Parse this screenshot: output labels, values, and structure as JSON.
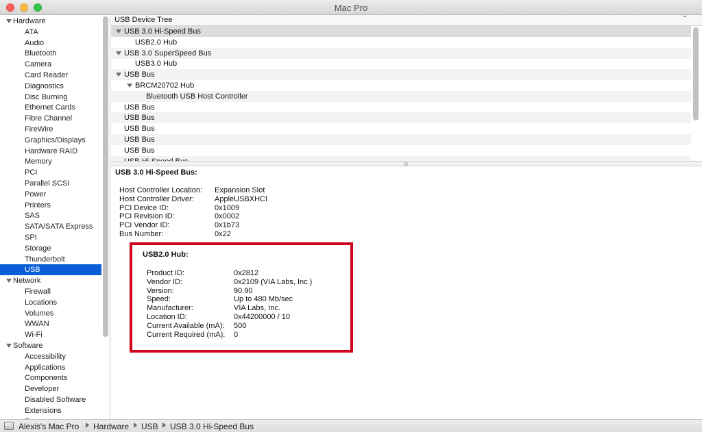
{
  "window": {
    "title": "Mac Pro"
  },
  "sidebar": {
    "items": [
      {
        "label": "Hardware",
        "kind": "category"
      },
      {
        "label": "ATA",
        "kind": "item"
      },
      {
        "label": "Audio",
        "kind": "item"
      },
      {
        "label": "Bluetooth",
        "kind": "item"
      },
      {
        "label": "Camera",
        "kind": "item"
      },
      {
        "label": "Card Reader",
        "kind": "item"
      },
      {
        "label": "Diagnostics",
        "kind": "item"
      },
      {
        "label": "Disc Burning",
        "kind": "item"
      },
      {
        "label": "Ethernet Cards",
        "kind": "item"
      },
      {
        "label": "Fibre Channel",
        "kind": "item"
      },
      {
        "label": "FireWire",
        "kind": "item"
      },
      {
        "label": "Graphics/Displays",
        "kind": "item"
      },
      {
        "label": "Hardware RAID",
        "kind": "item"
      },
      {
        "label": "Memory",
        "kind": "item"
      },
      {
        "label": "PCI",
        "kind": "item"
      },
      {
        "label": "Parallel SCSI",
        "kind": "item"
      },
      {
        "label": "Power",
        "kind": "item"
      },
      {
        "label": "Printers",
        "kind": "item"
      },
      {
        "label": "SAS",
        "kind": "item"
      },
      {
        "label": "SATA/SATA Express",
        "kind": "item"
      },
      {
        "label": "SPI",
        "kind": "item"
      },
      {
        "label": "Storage",
        "kind": "item"
      },
      {
        "label": "Thunderbolt",
        "kind": "item"
      },
      {
        "label": "USB",
        "kind": "item",
        "selected": true
      },
      {
        "label": "Network",
        "kind": "category"
      },
      {
        "label": "Firewall",
        "kind": "item"
      },
      {
        "label": "Locations",
        "kind": "item"
      },
      {
        "label": "Volumes",
        "kind": "item"
      },
      {
        "label": "WWAN",
        "kind": "item"
      },
      {
        "label": "Wi-Fi",
        "kind": "item"
      },
      {
        "label": "Software",
        "kind": "category"
      },
      {
        "label": "Accessibility",
        "kind": "item"
      },
      {
        "label": "Applications",
        "kind": "item"
      },
      {
        "label": "Components",
        "kind": "item"
      },
      {
        "label": "Developer",
        "kind": "item"
      },
      {
        "label": "Disabled Software",
        "kind": "item"
      },
      {
        "label": "Extensions",
        "kind": "item"
      },
      {
        "label": "Fonts",
        "kind": "item"
      }
    ]
  },
  "tree": {
    "header": "USB Device Tree",
    "rows": [
      {
        "label": "USB 3.0 Hi-Speed Bus",
        "level": 0,
        "expanded": true,
        "selected": true
      },
      {
        "label": "USB2.0 Hub",
        "level": 1
      },
      {
        "label": "USB 3.0 SuperSpeed Bus",
        "level": 0,
        "expanded": true
      },
      {
        "label": "USB3.0 Hub",
        "level": 1
      },
      {
        "label": "USB Bus",
        "level": 0,
        "expanded": true
      },
      {
        "label": "BRCM20702 Hub",
        "level": 1,
        "expanded": true
      },
      {
        "label": "Bluetooth USB Host Controller",
        "level": 2
      },
      {
        "label": "USB Bus",
        "level": 0
      },
      {
        "label": "USB Bus",
        "level": 0
      },
      {
        "label": "USB Bus",
        "level": 0
      },
      {
        "label": "USB Bus",
        "level": 0
      },
      {
        "label": "USB Bus",
        "level": 0
      },
      {
        "label": "USB Hi-Speed Bus",
        "level": 0
      }
    ]
  },
  "detail": {
    "title": "USB 3.0 Hi-Speed Bus:",
    "properties": [
      {
        "key": "Host Controller Location:",
        "value": "Expansion Slot"
      },
      {
        "key": "Host Controller Driver:",
        "value": "AppleUSBXHCI"
      },
      {
        "key": "PCI Device ID:",
        "value": "0x1009"
      },
      {
        "key": "PCI Revision ID:",
        "value": "0x0002"
      },
      {
        "key": "PCI Vendor ID:",
        "value": "0x1b73"
      },
      {
        "key": "Bus Number:",
        "value": "0x22"
      }
    ],
    "hub": {
      "title": "USB2.0 Hub:",
      "properties": [
        {
          "key": "Product ID:",
          "value": "0x2812"
        },
        {
          "key": "Vendor ID:",
          "value": "0x2109  (VIA Labs, Inc.)"
        },
        {
          "key": "Version:",
          "value": "90.90"
        },
        {
          "key": "Speed:",
          "value": "Up to 480 Mb/sec"
        },
        {
          "key": "Manufacturer:",
          "value": "VIA Labs, Inc."
        },
        {
          "key": "Location ID:",
          "value": "0x44200000 / 10"
        },
        {
          "key": "Current Available (mA):",
          "value": "500"
        },
        {
          "key": "Current Required (mA):",
          "value": "0"
        }
      ]
    }
  },
  "statusbar": {
    "path": [
      "Alexis's Mac Pro",
      "Hardware",
      "USB",
      "USB 3.0 Hi-Speed Bus"
    ]
  },
  "colors": {
    "selection": "#0a5fd6",
    "highlight_box": "#d1001c"
  }
}
